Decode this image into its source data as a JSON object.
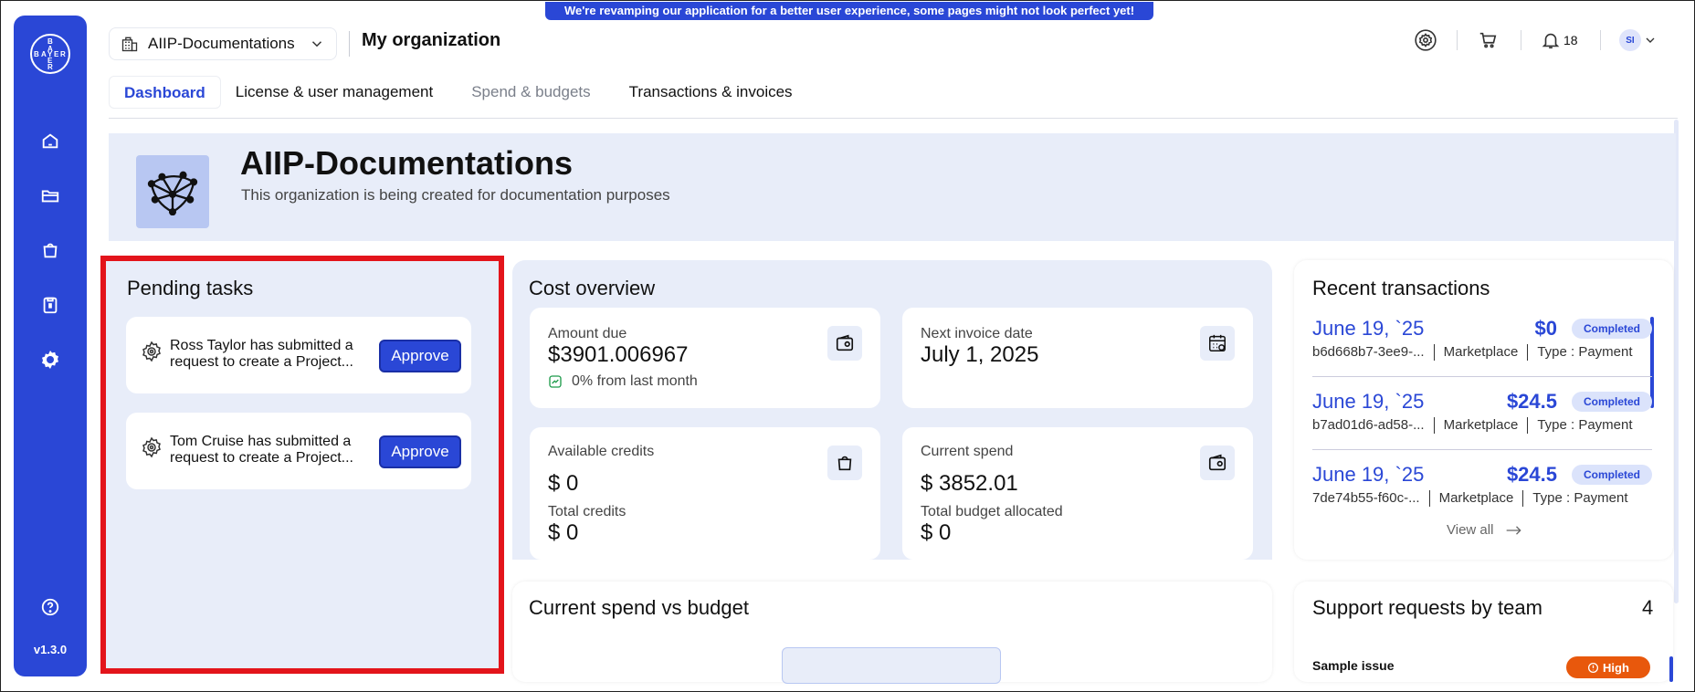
{
  "banner": "We're revamping our application for a better user experience, some pages might not look perfect yet!",
  "sidebar": {
    "logo_text": [
      "B",
      "A",
      "Y",
      "E",
      "R"
    ],
    "items": [
      "home-icon",
      "folder-icon",
      "bag-icon",
      "clipboard-icon",
      "settings-icon"
    ],
    "help": "help-icon",
    "version": "v1.3.0"
  },
  "header": {
    "org_name": "AIIP-Documentations",
    "page_title": "My organization",
    "notifications_count": "18",
    "avatar_initials": "SI"
  },
  "tabs": [
    {
      "label": "Dashboard",
      "active": true
    },
    {
      "label": "License & user management"
    },
    {
      "label": "Spend & budgets",
      "muted": true
    },
    {
      "label": "Transactions & invoices"
    }
  ],
  "hero": {
    "title": "AIIP-Documentations",
    "subtitle": "This organization is being created for documentation purposes"
  },
  "pending": {
    "title": "Pending tasks",
    "tasks": [
      {
        "text": "Ross Taylor has submitted a request to create a Project...",
        "action": "Approve"
      },
      {
        "text": "Tom Cruise has submitted a request to create a Project...",
        "action": "Approve"
      }
    ]
  },
  "cost": {
    "title": "Cost overview",
    "amount_due_label": "Amount due",
    "amount_due": "$3901.006967",
    "amount_due_change": "0% from last month",
    "next_invoice_label": "Next invoice date",
    "next_invoice": "July 1, 2025",
    "available_credits_label": "Available credits",
    "available_credits": "$ 0",
    "total_credits_label": "Total credits",
    "total_credits": "$ 0",
    "current_spend_label": "Current spend",
    "current_spend": "$ 3852.01",
    "total_budget_label": "Total budget allocated",
    "total_budget": "$ 0"
  },
  "recent": {
    "title": "Recent transactions",
    "items": [
      {
        "date": "June 19, `25",
        "amount": "$0",
        "status": "Completed",
        "id": "b6d668b7-3ee9-...",
        "source": "Marketplace",
        "type": "Type : Payment"
      },
      {
        "date": "June 19, `25",
        "amount": "$24.5",
        "status": "Completed",
        "id": "b7ad01d6-ad58-...",
        "source": "Marketplace",
        "type": "Type : Payment"
      },
      {
        "date": "June 19, `25",
        "amount": "$24.5",
        "status": "Completed",
        "id": "7de74b55-f60c-...",
        "source": "Marketplace",
        "type": "Type : Payment"
      }
    ],
    "view_all": "View all"
  },
  "spend_vs_budget": {
    "title": "Current spend vs budget"
  },
  "support": {
    "title": "Support requests by team",
    "count": "4",
    "first_issue": "Sample issue",
    "first_priority": "High"
  },
  "colors": {
    "accent": "#2a47d6",
    "panel_bg": "#e8edf9",
    "highlight": "#e3141b",
    "priority_high": "#e8580c"
  }
}
